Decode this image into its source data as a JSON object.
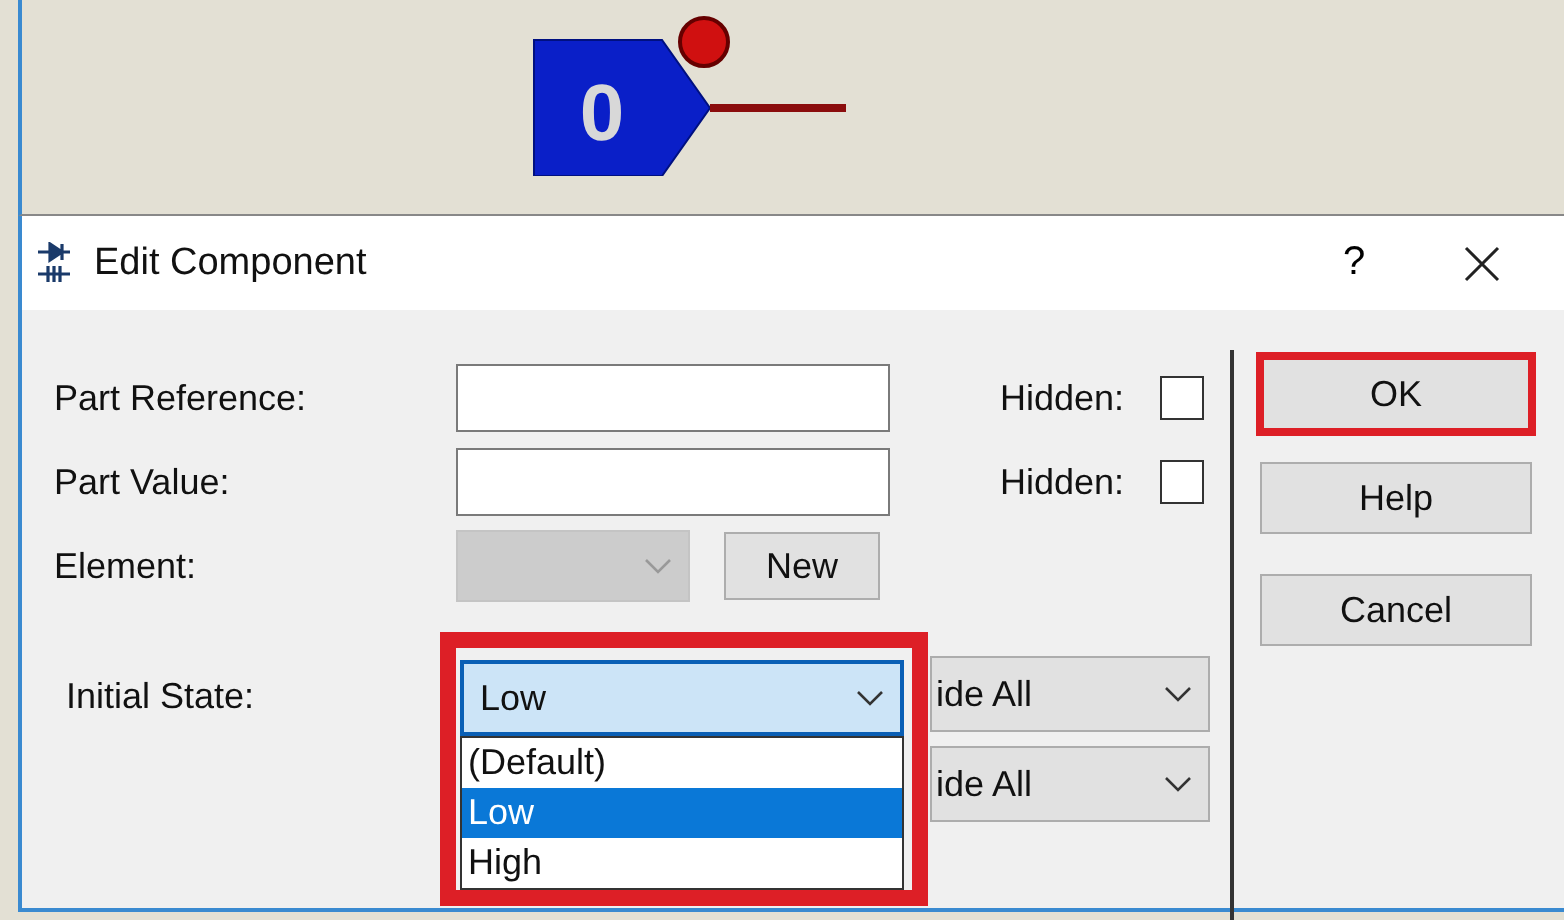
{
  "canvas": {
    "state_value": "0"
  },
  "dialog": {
    "title": "Edit Component",
    "help": "?"
  },
  "fields": [
    {
      "label": "Part Reference:",
      "hidden_label": "Hidden:",
      "hidden_checked": false
    },
    {
      "label": "Part Value:",
      "hidden_label": "Hidden:",
      "hidden_checked": false
    }
  ],
  "element": {
    "label": "Element:",
    "disabled": true,
    "new_button": "New"
  },
  "initial_state": {
    "label": "Initial State:",
    "value": "Low",
    "expanded": true,
    "highlighted": true,
    "options": [
      {
        "label": "(Default)",
        "selected": false
      },
      {
        "label": "Low",
        "selected": true
      },
      {
        "label": "High",
        "selected": false
      }
    ]
  },
  "visibility_combos": [
    {
      "value": "ide All"
    },
    {
      "value": "ide All"
    }
  ],
  "buttons": [
    {
      "label": "OK",
      "highlighted": true
    },
    {
      "label": "Help",
      "highlighted": false
    },
    {
      "label": "Cancel",
      "highlighted": false
    }
  ]
}
